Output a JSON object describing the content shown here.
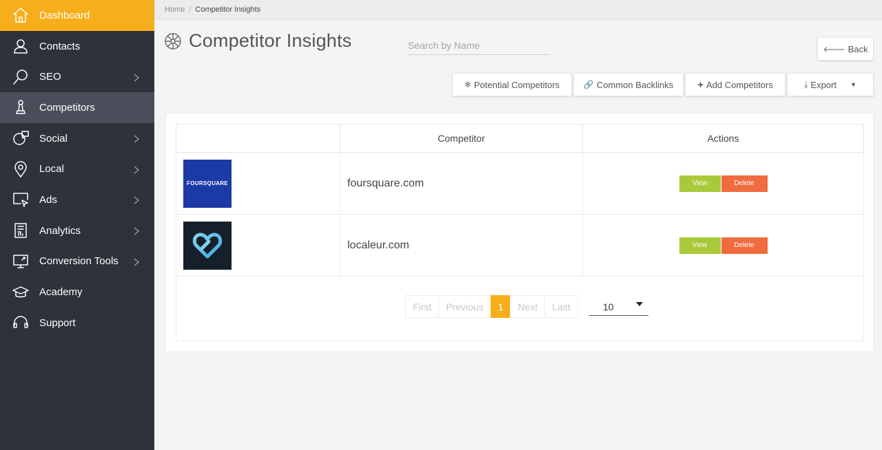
{
  "sidebar": {
    "items": [
      {
        "label": "Dashboard",
        "icon": "home-icon"
      },
      {
        "label": "Contacts",
        "icon": "user-icon"
      },
      {
        "label": "SEO",
        "icon": "magnifier-icon"
      },
      {
        "label": "Competitors",
        "icon": "chess-pawn-icon"
      },
      {
        "label": "Social",
        "icon": "social-chat-icon"
      },
      {
        "label": "Local",
        "icon": "map-pin-icon"
      },
      {
        "label": "Ads",
        "icon": "cursor-window-icon"
      },
      {
        "label": "Analytics",
        "icon": "report-icon"
      },
      {
        "label": "Conversion Tools",
        "icon": "monitor-icon"
      },
      {
        "label": "Academy",
        "icon": "graduation-cap-icon"
      },
      {
        "label": "Support",
        "icon": "headset-icon"
      }
    ]
  },
  "breadcrumb": {
    "home": "Home",
    "separator": "/",
    "current": "Competitor Insights"
  },
  "page": {
    "title": "Competitor Insights"
  },
  "search": {
    "placeholder": "Search by Name"
  },
  "buttons": {
    "back": "Back",
    "potential": "Potential Competitors",
    "backlinks": "Common Backlinks",
    "add": "Add Competitors",
    "export": "Export"
  },
  "table": {
    "headers": [
      "",
      "Competitor",
      "Actions"
    ],
    "rows": [
      {
        "logo_text": "FOURSQUARE",
        "domain": "foursquare.com",
        "view": "View",
        "delete": "Delete"
      },
      {
        "logo_text": "",
        "domain": "localeur.com",
        "view": "View",
        "delete": "Delete"
      }
    ]
  },
  "pagination": {
    "first": "First",
    "previous": "Previous",
    "current": "1",
    "next": "Next",
    "last": "Last",
    "page_size": "10"
  },
  "colors": {
    "accent": "#f6ae1b",
    "sidebar": "#2f323b",
    "view": "#a9c93a",
    "delete": "#f06b3e"
  }
}
